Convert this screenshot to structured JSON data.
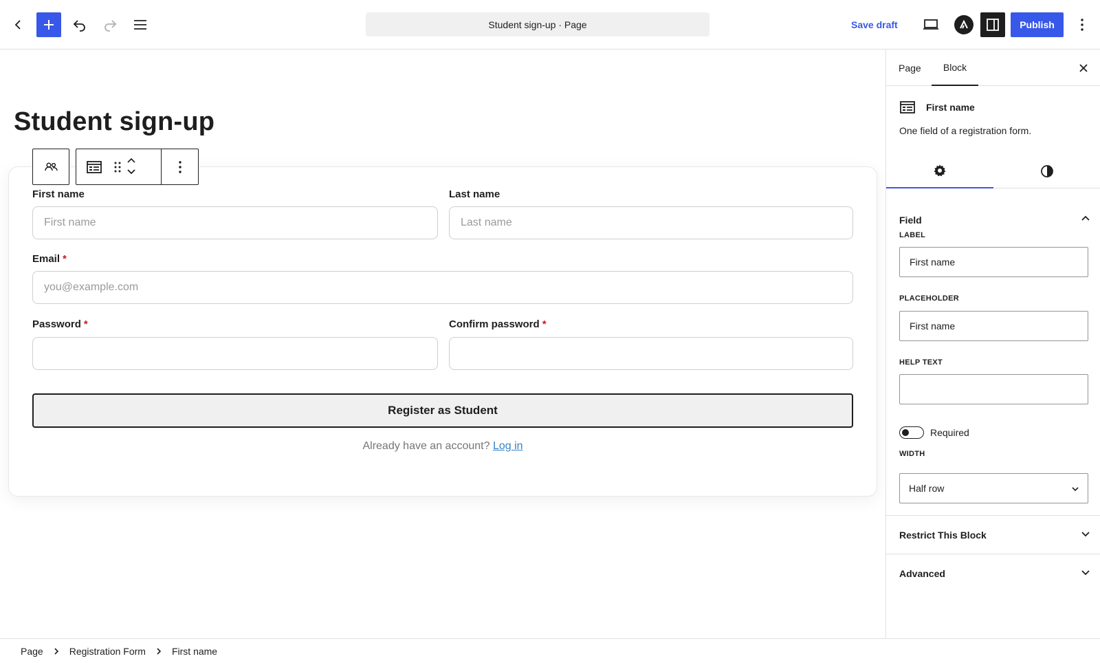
{
  "topbar": {
    "document_title": "Student sign-up · Page",
    "save_draft": "Save draft",
    "publish": "Publish"
  },
  "page": {
    "title": "Student sign-up"
  },
  "form": {
    "first_name": {
      "label": "First name",
      "placeholder": "First name"
    },
    "last_name": {
      "label": "Last name",
      "placeholder": "Last name"
    },
    "email": {
      "label": "Email",
      "required_mark": "*",
      "placeholder": "you@example.com"
    },
    "password": {
      "label": "Password",
      "required_mark": "*"
    },
    "confirm_password": {
      "label": "Confirm password",
      "required_mark": "*"
    },
    "submit": "Register as Student",
    "login_prompt": "Already have an account?",
    "login_link": "Log in"
  },
  "sidebar": {
    "tabs": [
      "Page",
      "Block"
    ],
    "block_name": "First name",
    "block_description": "One field of a registration form.",
    "panel_field": "Field",
    "label_caption": "LABEL",
    "label_value": "First name",
    "placeholder_caption": "PLACEHOLDER",
    "placeholder_value": "First name",
    "help_caption": "HELP TEXT",
    "help_value": "",
    "required_label": "Required",
    "width_caption": "WIDTH",
    "width_value": "Half row",
    "panel_restrict": "Restrict This Block",
    "panel_advanced": "Advanced"
  },
  "breadcrumb": [
    "Page",
    "Registration Form",
    "First name"
  ],
  "colors": {
    "accent": "#3858e9",
    "required": "#cc1818",
    "link": "#3582c4"
  }
}
